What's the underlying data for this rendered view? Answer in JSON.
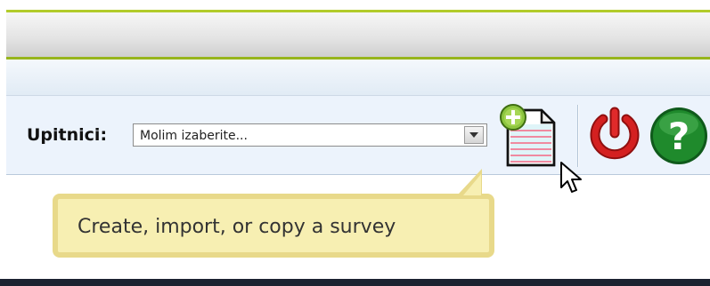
{
  "toolbar": {
    "survey_label": "Upitnici:",
    "survey_select": {
      "selected": "Molim izaberite..."
    },
    "buttons": [
      {
        "icon": "add-survey-icon"
      },
      {
        "icon": "power-icon"
      },
      {
        "icon": "help-icon"
      }
    ]
  },
  "tooltip": {
    "text": "Create, import, or copy a survey"
  },
  "colors": {
    "accent_green": "#97b51c",
    "toolbar_bg": "#ecf3fc",
    "tooltip_bg": "#f7efb2",
    "tooltip_border": "#e8d98a",
    "power_red": "#d42020",
    "help_green": "#1f8a2c"
  }
}
